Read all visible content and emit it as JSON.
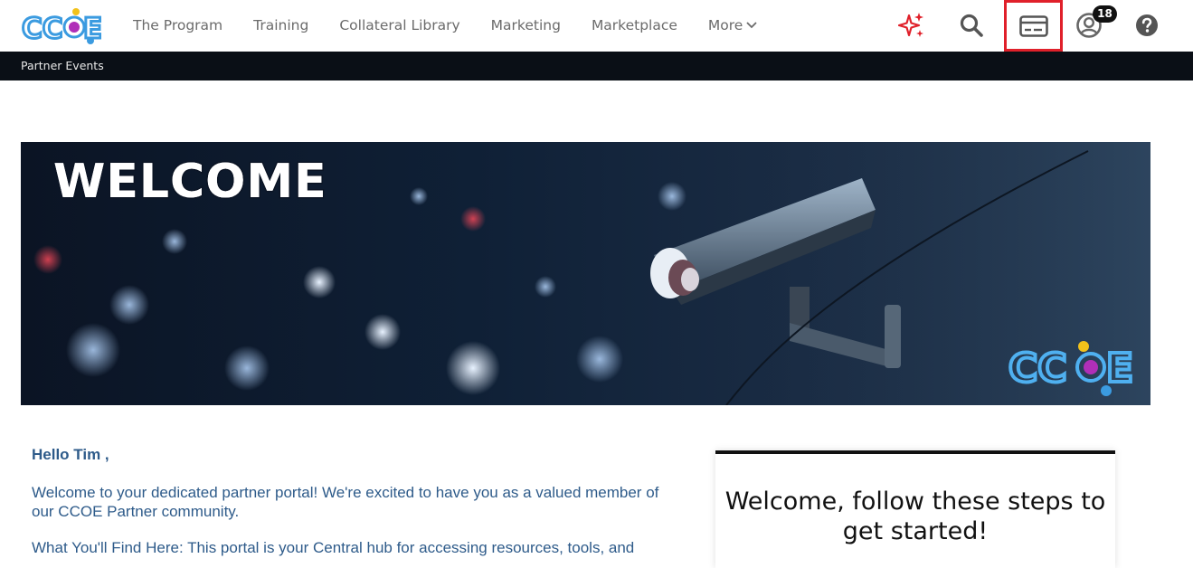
{
  "nav": {
    "logo_alt": "CCOE",
    "links": [
      "The Program",
      "Training",
      "Collateral Library",
      "Marketing",
      "Marketplace"
    ],
    "more_label": "More",
    "notification_count": "18"
  },
  "subnav": {
    "item": "Partner Events"
  },
  "banner": {
    "title": "WELCOME",
    "logo_text": "CCOE"
  },
  "content": {
    "greeting": "Hello Tim ,",
    "para1": "Welcome to your dedicated partner portal! We're excited to have you as a valued member of our CCOE Partner community.",
    "para2": "What You'll Find Here: This portal is your Central hub for accessing resources, tools, and"
  },
  "steps": {
    "title": "Welcome, follow these steps to get started!"
  },
  "colors": {
    "highlight": "#e0202a",
    "text_blue": "#2e5b8a",
    "subnav_bg": "#0a0f16"
  }
}
